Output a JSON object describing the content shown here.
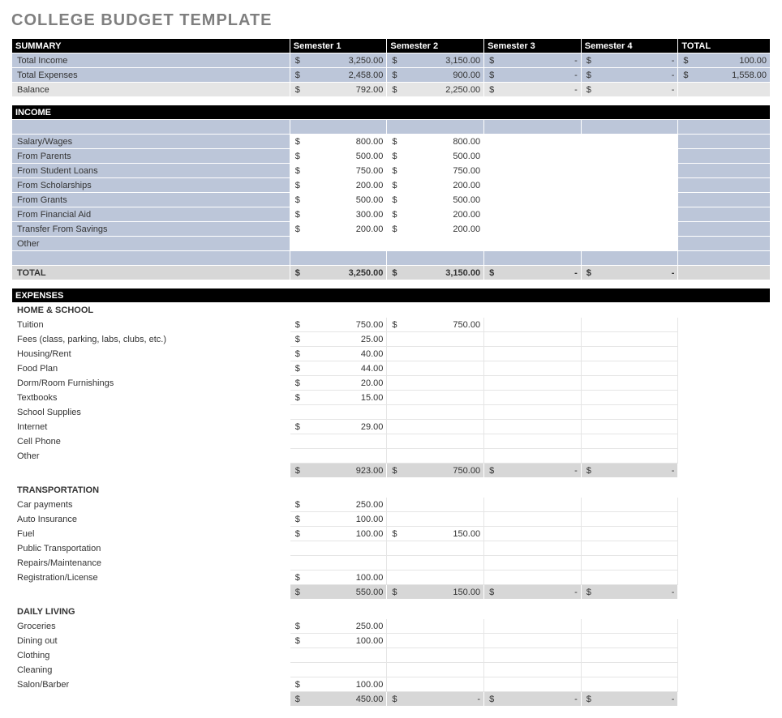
{
  "title": "COLLEGE BUDGET TEMPLATE",
  "headers": {
    "summary": "SUMMARY",
    "sem1": "Semester 1",
    "sem2": "Semester 2",
    "sem3": "Semester 3",
    "sem4": "Semester 4",
    "total": "TOTAL",
    "income": "INCOME",
    "expenses": "EXPENSES"
  },
  "currency": "$",
  "dash": "-",
  "summaryRows": [
    {
      "label": "Total Income",
      "vals": [
        "3,250.00",
        "3,150.00",
        "-",
        "-"
      ],
      "total": "100.00"
    },
    {
      "label": "Total Expenses",
      "vals": [
        "2,458.00",
        "900.00",
        "-",
        "-"
      ],
      "total": "1,558.00"
    },
    {
      "label": "Balance",
      "vals": [
        "792.00",
        "2,250.00",
        "-",
        "-"
      ],
      "total": ""
    }
  ],
  "incomeRows": [
    {
      "label": "Salary/Wages",
      "vals": [
        "800.00",
        "800.00",
        "",
        ""
      ]
    },
    {
      "label": "From Parents",
      "vals": [
        "500.00",
        "500.00",
        "",
        ""
      ]
    },
    {
      "label": "From Student Loans",
      "vals": [
        "750.00",
        "750.00",
        "",
        ""
      ]
    },
    {
      "label": "From Scholarships",
      "vals": [
        "200.00",
        "200.00",
        "",
        ""
      ]
    },
    {
      "label": "From Grants",
      "vals": [
        "500.00",
        "500.00",
        "",
        ""
      ]
    },
    {
      "label": "From Financial Aid",
      "vals": [
        "300.00",
        "200.00",
        "",
        ""
      ]
    },
    {
      "label": "Transfer From Savings",
      "vals": [
        "200.00",
        "200.00",
        "",
        ""
      ]
    },
    {
      "label": "Other",
      "vals": [
        "",
        "",
        "",
        ""
      ]
    }
  ],
  "incomeTotal": {
    "label": "TOTAL",
    "vals": [
      "3,250.00",
      "3,150.00",
      "-",
      "-"
    ]
  },
  "expenseSections": [
    {
      "header": "HOME & SCHOOL",
      "rows": [
        {
          "label": "Tuition",
          "vals": [
            "750.00",
            "750.00",
            "",
            ""
          ]
        },
        {
          "label": "Fees (class, parking, labs, clubs, etc.)",
          "vals": [
            "25.00",
            "",
            "",
            ""
          ]
        },
        {
          "label": "Housing/Rent",
          "vals": [
            "40.00",
            "",
            "",
            ""
          ]
        },
        {
          "label": "Food Plan",
          "vals": [
            "44.00",
            "",
            "",
            ""
          ]
        },
        {
          "label": "Dorm/Room Furnishings",
          "vals": [
            "20.00",
            "",
            "",
            ""
          ]
        },
        {
          "label": "Textbooks",
          "vals": [
            "15.00",
            "",
            "",
            ""
          ]
        },
        {
          "label": "School Supplies",
          "vals": [
            "",
            "",
            "",
            ""
          ]
        },
        {
          "label": "Internet",
          "vals": [
            "29.00",
            "",
            "",
            ""
          ]
        },
        {
          "label": "Cell Phone",
          "vals": [
            "",
            "",
            "",
            ""
          ]
        },
        {
          "label": "Other",
          "vals": [
            "",
            "",
            "",
            ""
          ]
        }
      ],
      "subtotal": [
        "923.00",
        "750.00",
        "-",
        "-"
      ]
    },
    {
      "header": "TRANSPORTATION",
      "rows": [
        {
          "label": "Car payments",
          "vals": [
            "250.00",
            "",
            "",
            ""
          ]
        },
        {
          "label": "Auto Insurance",
          "vals": [
            "100.00",
            "",
            "",
            ""
          ]
        },
        {
          "label": "Fuel",
          "vals": [
            "100.00",
            "150.00",
            "",
            ""
          ]
        },
        {
          "label": "Public Transportation",
          "vals": [
            "",
            "",
            "",
            ""
          ]
        },
        {
          "label": "Repairs/Maintenance",
          "vals": [
            "",
            "",
            "",
            ""
          ]
        },
        {
          "label": "Registration/License",
          "vals": [
            "100.00",
            "",
            "",
            ""
          ]
        }
      ],
      "subtotal": [
        "550.00",
        "150.00",
        "-",
        "-"
      ]
    },
    {
      "header": "DAILY LIVING",
      "rows": [
        {
          "label": "Groceries",
          "vals": [
            "250.00",
            "",
            "",
            ""
          ]
        },
        {
          "label": "Dining out",
          "vals": [
            "100.00",
            "",
            "",
            ""
          ]
        },
        {
          "label": "Clothing",
          "vals": [
            "",
            "",
            "",
            ""
          ]
        },
        {
          "label": "Cleaning",
          "vals": [
            "",
            "",
            "",
            ""
          ]
        },
        {
          "label": "Salon/Barber",
          "vals": [
            "100.00",
            "",
            "",
            ""
          ]
        }
      ],
      "subtotal": [
        "450.00",
        "-",
        "-",
        "-"
      ]
    }
  ]
}
